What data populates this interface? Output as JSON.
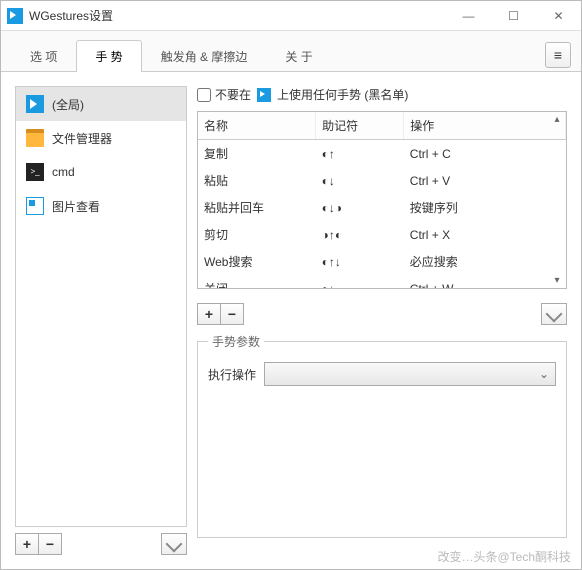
{
  "window": {
    "title": "WGestures设置"
  },
  "winControls": {
    "min": "—",
    "max": "☐",
    "close": "✕"
  },
  "tabs": [
    "选  项",
    "手  势",
    "触发角  &  摩擦边",
    "关  于"
  ],
  "activeTabIndex": 1,
  "hamburger": "≡",
  "sidebar": {
    "items": [
      {
        "label": "(全局)",
        "iconClass": "cursor"
      },
      {
        "label": "文件管理器",
        "iconClass": "folder"
      },
      {
        "label": "cmd",
        "iconClass": "cmd",
        "iconText": ">_"
      },
      {
        "label": "图片查看",
        "iconClass": "viewer"
      }
    ],
    "selectedIndex": 0,
    "btns": {
      "add": "+",
      "remove": "−"
    }
  },
  "blacklist": {
    "pre": "不要在",
    "post": "上使用任何手势  (黑名单)"
  },
  "table": {
    "headers": [
      "名称",
      "助记符",
      "操作"
    ],
    "rows": [
      [
        "复制",
        "◐↑",
        "Ctrl + C"
      ],
      [
        "粘贴",
        "◐↓",
        "Ctrl + V"
      ],
      [
        "粘贴并回车",
        "◐↓◑",
        "按键序列"
      ],
      [
        "剪切",
        "◑↑◐",
        "Ctrl + X"
      ],
      [
        "Web搜索",
        "◐↑↓",
        "必应搜索"
      ],
      [
        "关闭",
        "◐↓→",
        "Ctrl + W"
      ]
    ],
    "btns": {
      "add": "+",
      "remove": "−"
    }
  },
  "params": {
    "legend": "手势参数",
    "label": "执行操作",
    "comboValue": ""
  },
  "watermark": "改变…头条@Tech酮科技"
}
